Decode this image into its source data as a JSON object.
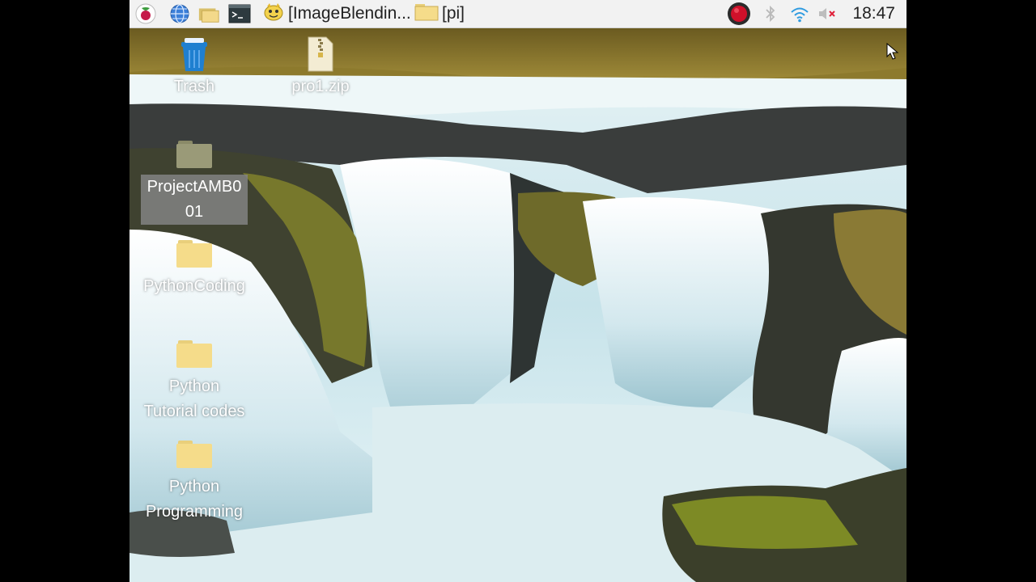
{
  "taskbar": {
    "icons": [
      "raspberry-menu-icon",
      "web-browser-icon",
      "file-manager-icon",
      "terminal-icon"
    ],
    "tasks": [
      {
        "label": "[ImageBlendin...",
        "icon": "python-ide-icon"
      },
      {
        "label": "[pi]",
        "icon": "folder-icon"
      }
    ],
    "tray": [
      "record-icon",
      "bluetooth-icon",
      "wifi-icon",
      "volume-muted-icon"
    ],
    "clock": "18:47"
  },
  "desktop": {
    "items": [
      {
        "label": "Trash",
        "icon": "trash-icon"
      },
      {
        "label": "pro1.zip",
        "icon": "zip-file-icon"
      },
      {
        "label": "ProjectAMB001",
        "icon": "folder-icon",
        "selected": true,
        "label_lines": [
          "ProjectAMB0",
          "01"
        ]
      },
      {
        "label": "PythonCoding",
        "icon": "folder-icon"
      },
      {
        "label": "Python Tutorial codes",
        "icon": "folder-icon",
        "label_lines": [
          "Python",
          "Tutorial codes"
        ]
      },
      {
        "label": "Python Programming",
        "icon": "folder-icon",
        "label_lines": [
          "Python",
          "Programming"
        ]
      }
    ]
  },
  "colors": {
    "taskbar_bg": "#f2f2f2",
    "folder": "#f5dc8a",
    "trash": "#1f7fd0",
    "record_red": "#d0102a"
  }
}
